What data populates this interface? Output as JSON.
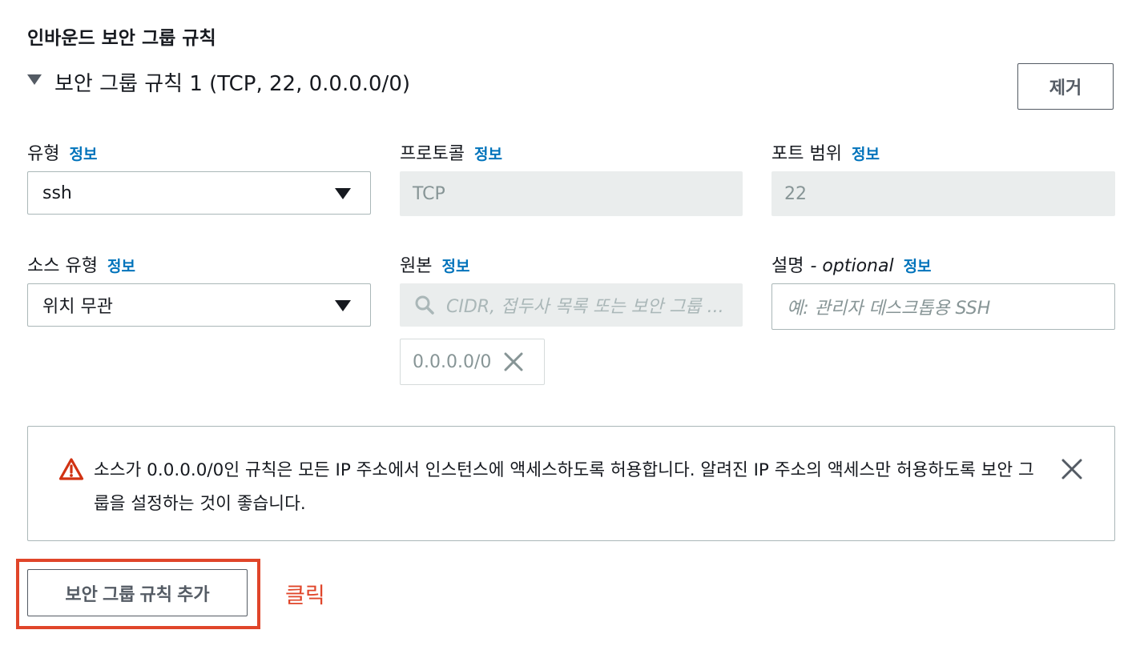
{
  "section": {
    "title": "인바운드 보안 그룹 규칙"
  },
  "rule": {
    "title": "보안 그룹 규칙 1 (TCP, 22, 0.0.0.0/0)",
    "remove_label": "제거",
    "type": {
      "label": "유형",
      "info": "정보",
      "value": "ssh"
    },
    "protocol": {
      "label": "프로토콜",
      "info": "정보",
      "value": "TCP"
    },
    "port_range": {
      "label": "포트 범위",
      "info": "정보",
      "value": "22"
    },
    "source_type": {
      "label": "소스 유형",
      "info": "정보",
      "value": "위치 무관"
    },
    "source": {
      "label": "원본",
      "info": "정보",
      "placeholder": "CIDR, 접두사 목록 또는 보안 그룹 ...",
      "token": "0.0.0.0/0"
    },
    "description": {
      "label": "설명",
      "label_suffix": "- optional",
      "info": "정보",
      "placeholder": "예: 관리자 데스크톱용 SSH"
    }
  },
  "alert": {
    "text": "소스가 0.0.0.0/0인 규칙은 모든 IP 주소에서 인스턴스에 액세스하도록 허용합니다. 알려진 IP 주소의 액세스만 허용하도록 보안 그룹을 설정하는 것이 좋습니다.",
    "icon": "warning-icon"
  },
  "actions": {
    "add_rule_label": "보안 그룹 규칙 추가"
  },
  "annotation": {
    "text": "클릭",
    "color": "#e0452a"
  },
  "colors": {
    "link": "#0073bb",
    "warning": "#d13212",
    "highlight": "#e0452a"
  }
}
